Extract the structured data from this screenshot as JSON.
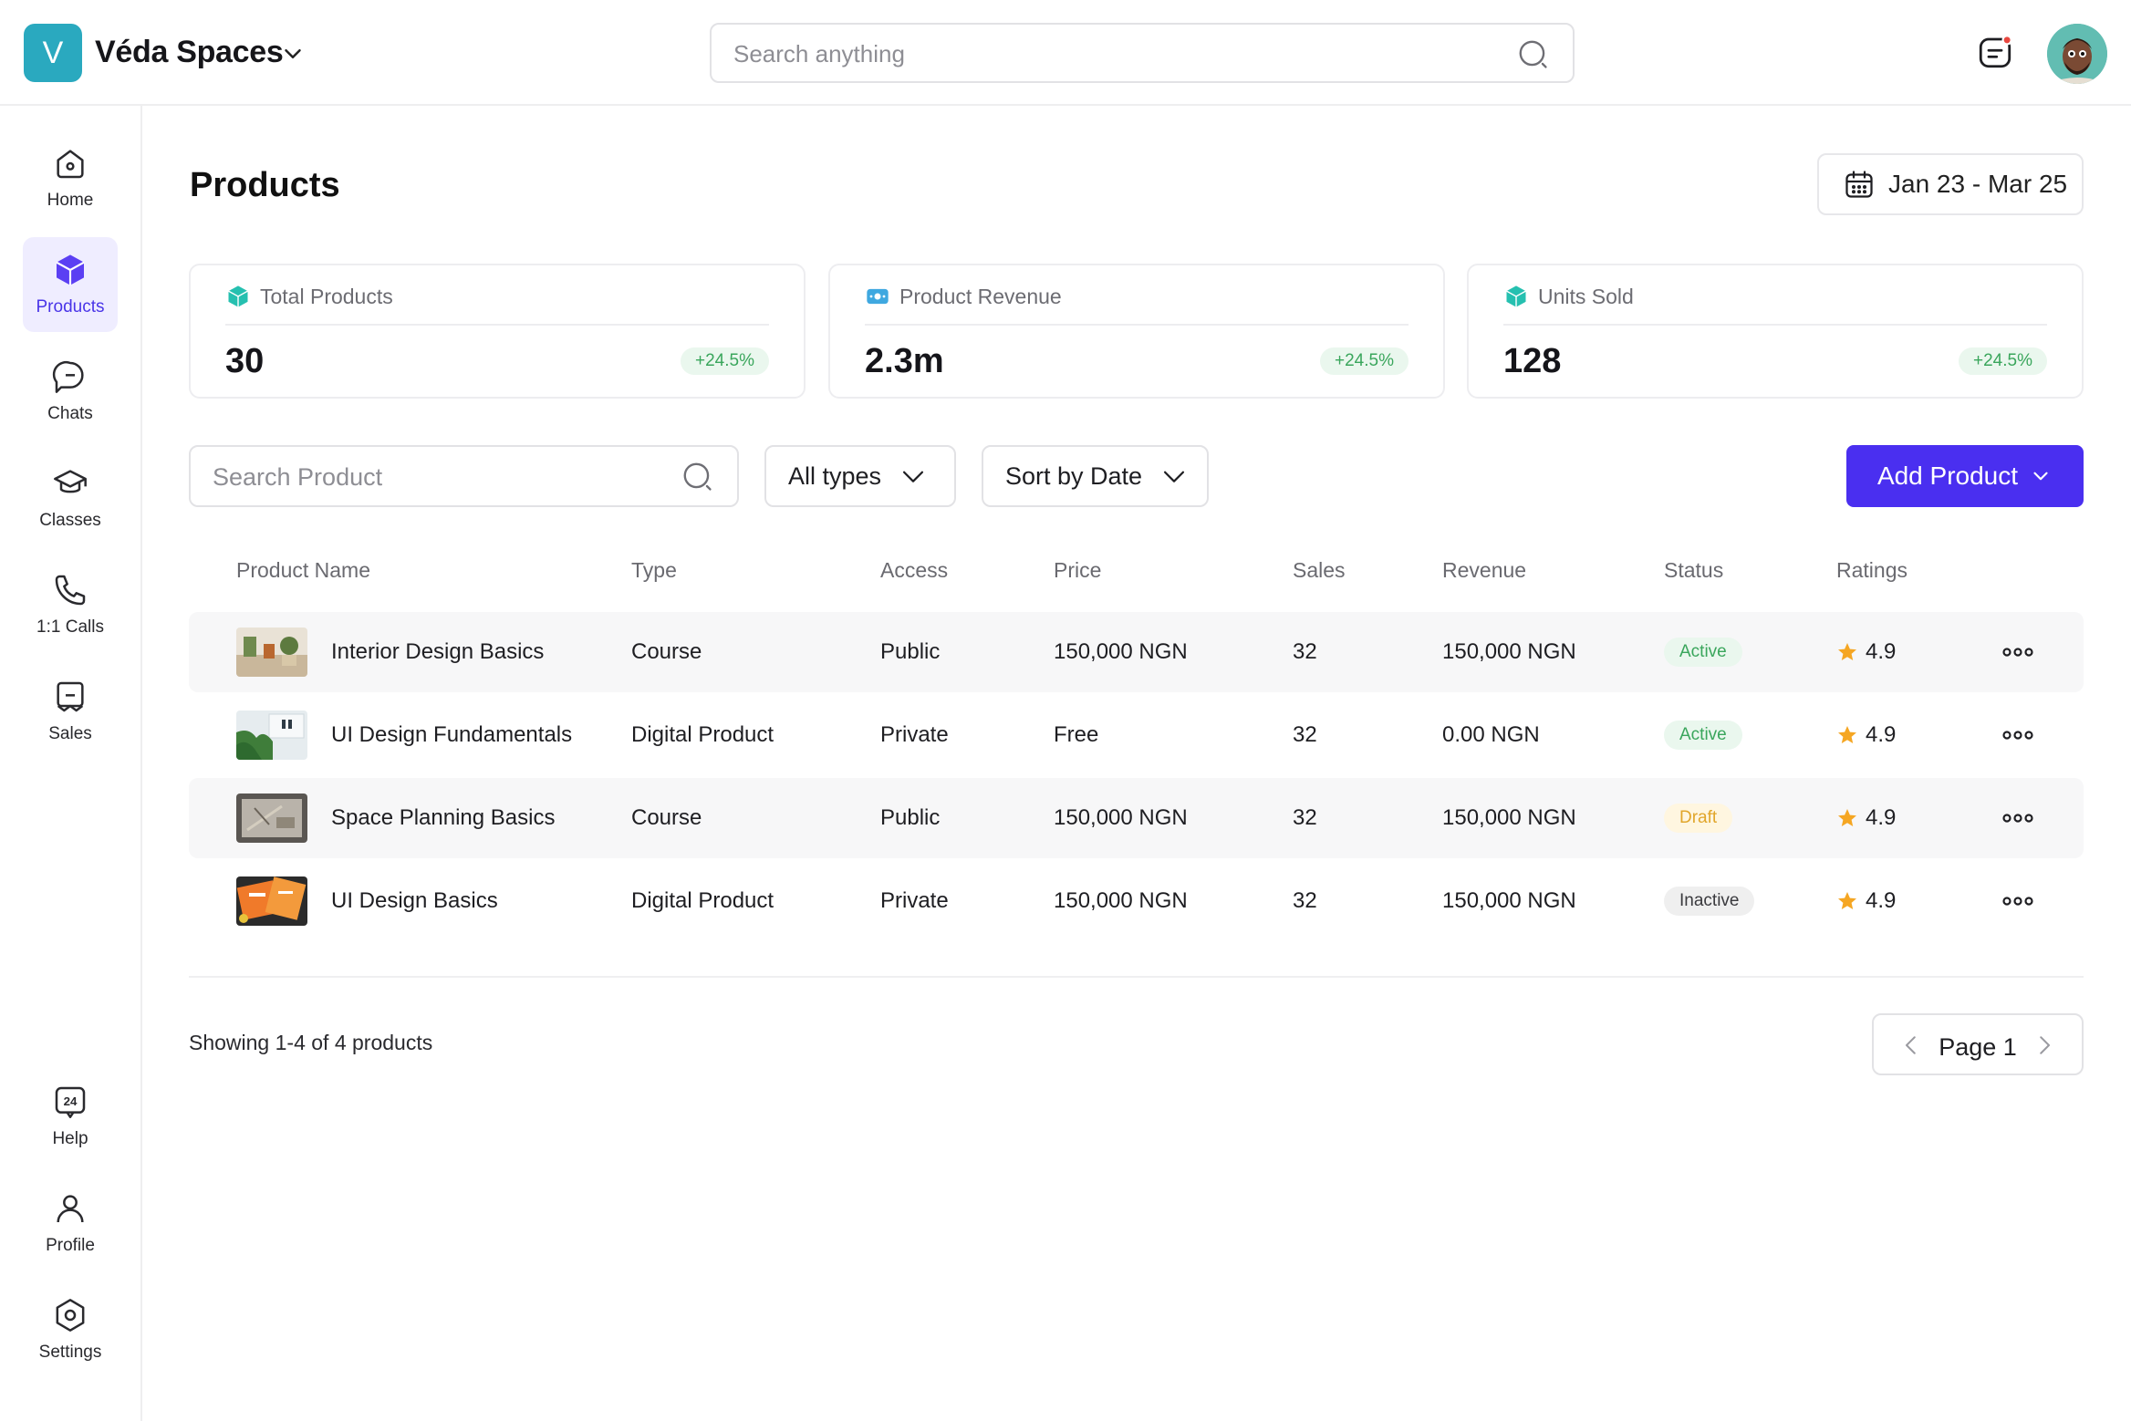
{
  "header": {
    "logo_letter": "V",
    "workspace_name": "Véda Spaces",
    "search_placeholder": "Search anything"
  },
  "sidebar": {
    "top_items": [
      {
        "label": "Home",
        "icon": "home-icon"
      },
      {
        "label": "Products",
        "icon": "cube-icon",
        "active": true
      },
      {
        "label": "Chats",
        "icon": "chat-icon"
      },
      {
        "label": "Classes",
        "icon": "graduation-cap-icon"
      },
      {
        "label": "1:1 Calls",
        "icon": "phone-icon"
      },
      {
        "label": "Sales",
        "icon": "receipt-icon"
      }
    ],
    "bottom_items": [
      {
        "label": "Help",
        "icon": "support-24-icon"
      },
      {
        "label": "Profile",
        "icon": "user-icon"
      },
      {
        "label": "Settings",
        "icon": "settings-icon"
      }
    ]
  },
  "page": {
    "title": "Products",
    "date_range": "Jan 23 - Mar 25"
  },
  "stats": [
    {
      "label": "Total Products",
      "value": "30",
      "delta": "+24.5%"
    },
    {
      "label": "Product Revenue",
      "value": "2.3m",
      "delta": "+24.5%"
    },
    {
      "label": "Units Sold",
      "value": "128",
      "delta": "+24.5%"
    }
  ],
  "toolbar": {
    "search_placeholder": "Search Product",
    "type_filter": "All types",
    "sort": "Sort by Date",
    "add_label": "Add Product"
  },
  "table": {
    "columns": [
      "Product Name",
      "Type",
      "Access",
      "Price",
      "Sales",
      "Revenue",
      "Status",
      "Ratings"
    ],
    "rows": [
      {
        "name": "Interior Design Basics",
        "type": "Course",
        "access": "Public",
        "price": "150,000 NGN",
        "sales": "32",
        "revenue": "150,000 NGN",
        "status": "Active",
        "rating": "4.9"
      },
      {
        "name": "UI Design Fundamentals",
        "type": "Digital Product",
        "access": "Private",
        "price": "Free",
        "sales": "32",
        "revenue": "0.00 NGN",
        "status": "Active",
        "rating": "4.9"
      },
      {
        "name": "Space Planning Basics",
        "type": "Course",
        "access": "Public",
        "price": "150,000 NGN",
        "sales": "32",
        "revenue": "150,000 NGN",
        "status": "Draft",
        "rating": "4.9"
      },
      {
        "name": "UI Design Basics",
        "type": "Digital Product",
        "access": "Private",
        "price": "150,000 NGN",
        "sales": "32",
        "revenue": "150,000 NGN",
        "status": "Inactive",
        "rating": "4.9"
      }
    ]
  },
  "footer": {
    "showing": "Showing 1-4 of 4 products",
    "page_label": "Page 1"
  },
  "colors": {
    "brand": "#2aa9bf",
    "primary": "#4a2ff0",
    "active_nav_bg": "#efedff",
    "success": "#3aa65c",
    "warning": "#e1a62b",
    "star": "#f5a623"
  }
}
